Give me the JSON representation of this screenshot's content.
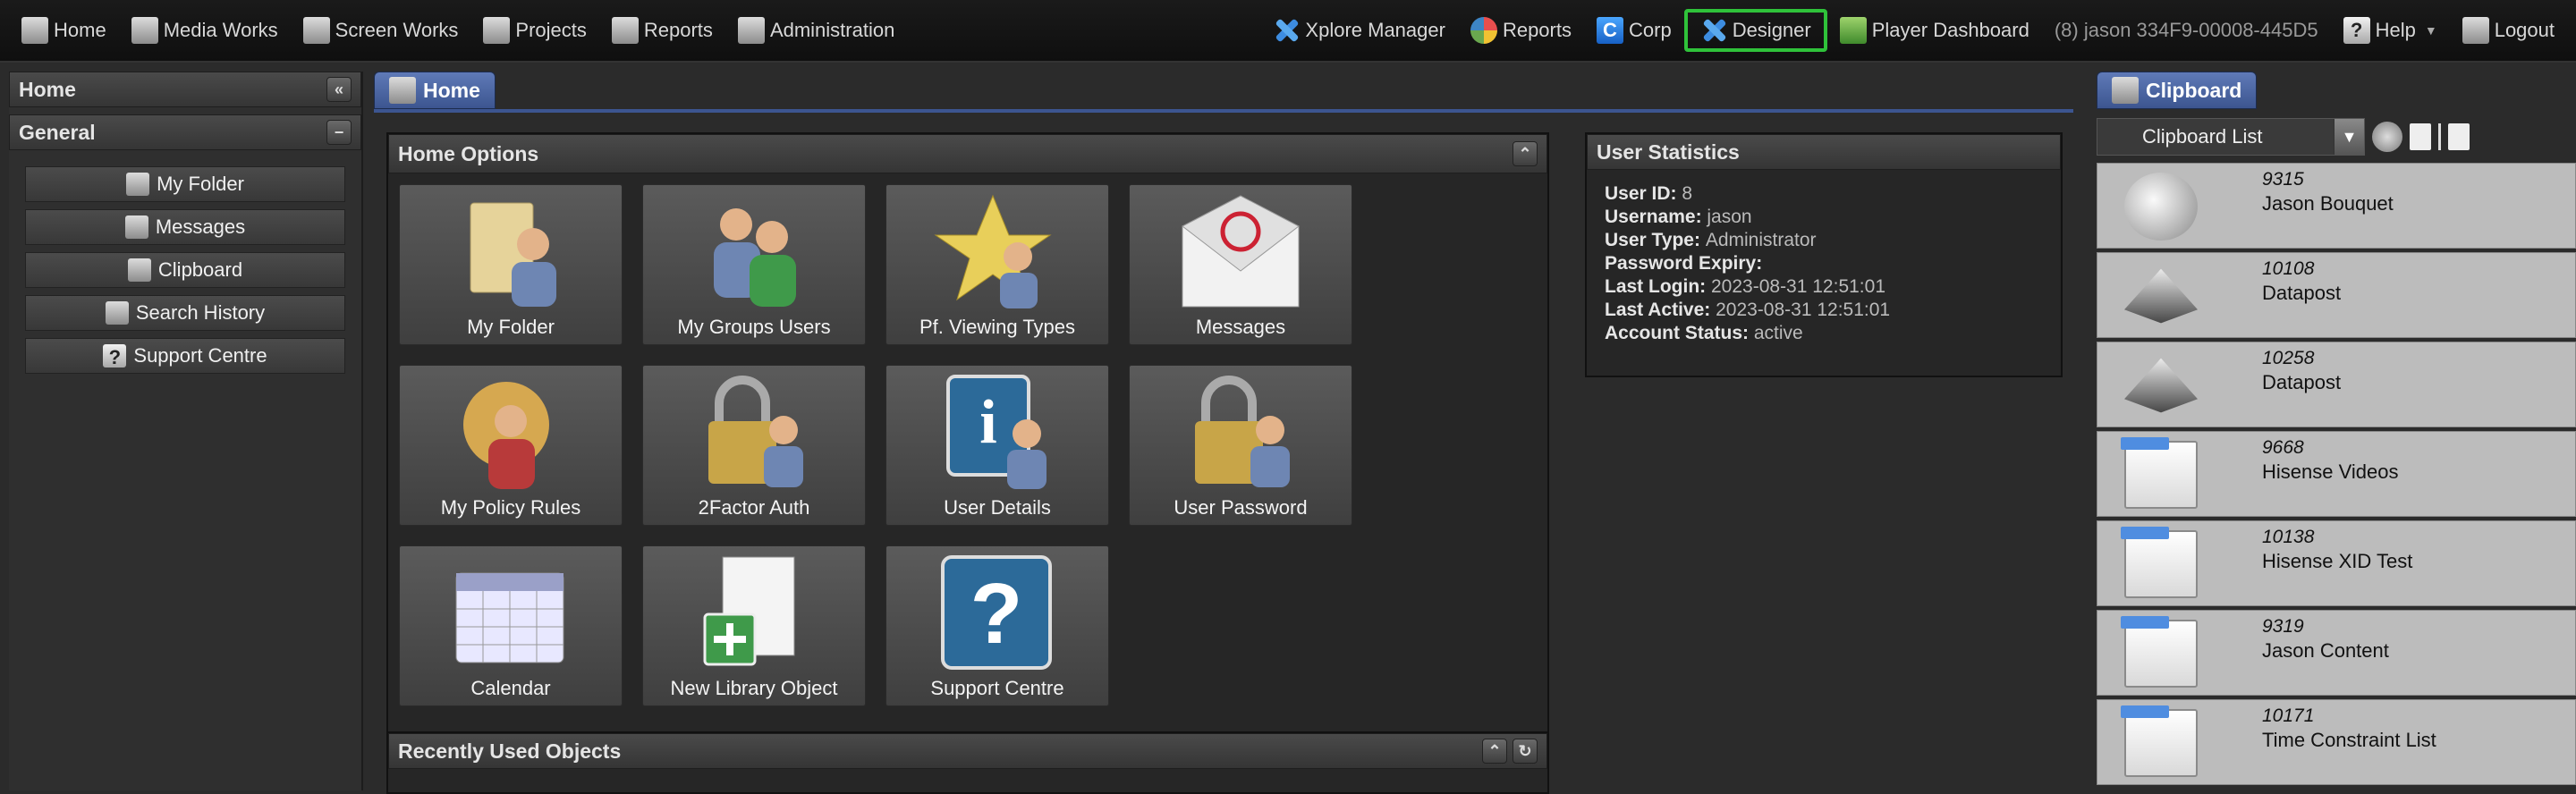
{
  "topbar": {
    "left": [
      {
        "label": "Home",
        "icon": "home-icon"
      },
      {
        "label": "Media Works",
        "icon": "media-works-icon"
      },
      {
        "label": "Screen Works",
        "icon": "screen-works-icon"
      },
      {
        "label": "Projects",
        "icon": "projects-icon"
      },
      {
        "label": "Reports",
        "icon": "reports-icon"
      },
      {
        "label": "Administration",
        "icon": "administration-icon"
      }
    ],
    "right": [
      {
        "label": "Xplore Manager",
        "icon": "xplore-icon"
      },
      {
        "label": "Reports",
        "icon": "reports-chart-icon"
      },
      {
        "label": "Corp",
        "icon": "corp-icon"
      },
      {
        "label": "Designer",
        "icon": "designer-icon"
      },
      {
        "label": "Player Dashboard",
        "icon": "player-dashboard-icon"
      },
      {
        "label": "(8) jason 334F9-00008-445D5"
      },
      {
        "label": "Help",
        "icon": "help-icon"
      },
      {
        "label": "Logout",
        "icon": "logout-icon"
      }
    ]
  },
  "sidebar": {
    "title": "Home",
    "section": "General",
    "items": [
      {
        "label": "My Folder"
      },
      {
        "label": "Messages"
      },
      {
        "label": "Clipboard"
      },
      {
        "label": "Search History"
      },
      {
        "label": "Support Centre"
      }
    ]
  },
  "main": {
    "tab": "Home",
    "options_title": "Home Options",
    "tiles": [
      {
        "label": "My Folder"
      },
      {
        "label": "My Groups Users"
      },
      {
        "label": "Pf. Viewing Types"
      },
      {
        "label": "Messages"
      },
      {
        "label": "My Policy Rules"
      },
      {
        "label": "2Factor Auth"
      },
      {
        "label": "User Details"
      },
      {
        "label": "User Password"
      },
      {
        "label": "Calendar"
      },
      {
        "label": "New Library Object"
      },
      {
        "label": "Support Centre"
      }
    ],
    "recent_title": "Recently Used Objects"
  },
  "stats": {
    "title": "User Statistics",
    "rows": [
      {
        "k": "User ID",
        "v": "8"
      },
      {
        "k": "Username",
        "v": "jason"
      },
      {
        "k": "User Type",
        "v": "Administrator"
      },
      {
        "k": "Password Expiry",
        "v": ""
      },
      {
        "k": "Last Login",
        "v": "2023-08-31 12:51:01"
      },
      {
        "k": "Last Active",
        "v": "2023-08-31 12:51:01"
      },
      {
        "k": "Account Status",
        "v": "active"
      }
    ]
  },
  "clipboard": {
    "tab": "Clipboard",
    "select_value": "Clipboard List",
    "items": [
      {
        "num": "9315",
        "name": "Jason Bouquet",
        "thumb": "cam"
      },
      {
        "num": "10108",
        "name": "Datapost",
        "thumb": "pyr"
      },
      {
        "num": "10258",
        "name": "Datapost",
        "thumb": "pyr"
      },
      {
        "num": "9668",
        "name": "Hisense Videos",
        "thumb": "doc"
      },
      {
        "num": "10138",
        "name": "Hisense XID Test",
        "thumb": "doc"
      },
      {
        "num": "9319",
        "name": "Jason Content",
        "thumb": "doc"
      },
      {
        "num": "10171",
        "name": "Time Constraint List",
        "thumb": "doc"
      }
    ]
  }
}
